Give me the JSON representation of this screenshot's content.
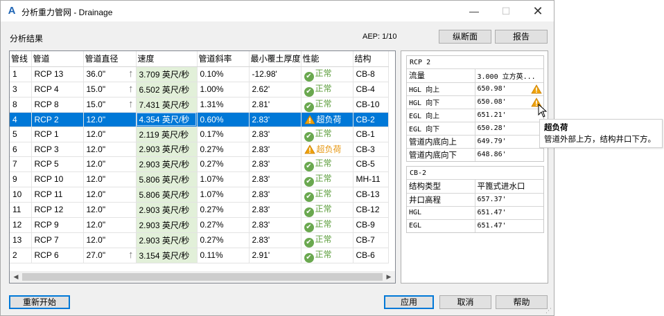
{
  "window": {
    "title": "分析重力管网 - Drainage",
    "app_icon": "A",
    "results_label": "分析结果",
    "aep": "AEP: 1/10",
    "controls": {
      "minimize": "—",
      "maximize": "☐",
      "close": "✕"
    }
  },
  "toolbar": {
    "profile_label": "纵断面",
    "report_label": "报告"
  },
  "table": {
    "columns": [
      "管线",
      "管道",
      "管道直径",
      "速度",
      "管道斜率",
      "最小覆土厚度",
      "性能",
      "结构"
    ],
    "rows": [
      {
        "line": "1",
        "pipe": "RCP 13",
        "dia": "36.0\"",
        "up": "↑",
        "vel": "3.709 英尺/秒",
        "slope": "0.10%",
        "cover": "-12.98'",
        "perf": "正常",
        "perf_type": "ok",
        "struct": "CB-8"
      },
      {
        "line": "3",
        "pipe": "RCP 4",
        "dia": "15.0\"",
        "up": "↑",
        "vel": "6.502 英尺/秒",
        "slope": "1.00%",
        "cover": "2.62'",
        "perf": "正常",
        "perf_type": "ok",
        "struct": "CB-4"
      },
      {
        "line": "8",
        "pipe": "RCP 8",
        "dia": "15.0\"",
        "up": "↑",
        "vel": "7.431 英尺/秒",
        "slope": "1.31%",
        "cover": "2.81'",
        "perf": "正常",
        "perf_type": "ok",
        "struct": "CB-10"
      },
      {
        "line": "4",
        "pipe": "RCP 2",
        "dia": "12.0\"",
        "up": "",
        "vel": "4.354 英尺/秒",
        "slope": "0.60%",
        "cover": "2.83'",
        "perf": "超负荷",
        "perf_type": "warn",
        "struct": "CB-2",
        "selected": true
      },
      {
        "line": "5",
        "pipe": "RCP 1",
        "dia": "12.0\"",
        "up": "",
        "vel": "2.119 英尺/秒",
        "slope": "0.17%",
        "cover": "2.83'",
        "perf": "正常",
        "perf_type": "ok",
        "struct": "CB-1"
      },
      {
        "line": "6",
        "pipe": "RCP 3",
        "dia": "12.0\"",
        "up": "",
        "vel": "2.903 英尺/秒",
        "slope": "0.27%",
        "cover": "2.83'",
        "perf": "超负荷",
        "perf_type": "warn",
        "struct": "CB-3"
      },
      {
        "line": "7",
        "pipe": "RCP 5",
        "dia": "12.0\"",
        "up": "",
        "vel": "2.903 英尺/秒",
        "slope": "0.27%",
        "cover": "2.83'",
        "perf": "正常",
        "perf_type": "ok",
        "struct": "CB-5"
      },
      {
        "line": "9",
        "pipe": "RCP 10",
        "dia": "12.0\"",
        "up": "",
        "vel": "5.806 英尺/秒",
        "slope": "1.07%",
        "cover": "2.83'",
        "perf": "正常",
        "perf_type": "ok",
        "struct": "MH-11"
      },
      {
        "line": "10",
        "pipe": "RCP 11",
        "dia": "12.0\"",
        "up": "",
        "vel": "5.806 英尺/秒",
        "slope": "1.07%",
        "cover": "2.83'",
        "perf": "正常",
        "perf_type": "ok",
        "struct": "CB-13"
      },
      {
        "line": "11",
        "pipe": "RCP 12",
        "dia": "12.0\"",
        "up": "",
        "vel": "2.903 英尺/秒",
        "slope": "0.27%",
        "cover": "2.83'",
        "perf": "正常",
        "perf_type": "ok",
        "struct": "CB-12"
      },
      {
        "line": "12",
        "pipe": "RCP 9",
        "dia": "12.0\"",
        "up": "",
        "vel": "2.903 英尺/秒",
        "slope": "0.27%",
        "cover": "2.83'",
        "perf": "正常",
        "perf_type": "ok",
        "struct": "CB-9"
      },
      {
        "line": "13",
        "pipe": "RCP 7",
        "dia": "12.0\"",
        "up": "",
        "vel": "2.903 英尺/秒",
        "slope": "0.27%",
        "cover": "2.83'",
        "perf": "正常",
        "perf_type": "ok",
        "struct": "CB-7"
      },
      {
        "line": "2",
        "pipe": "RCP 6",
        "dia": "27.0\"",
        "up": "↑",
        "vel": "3.154 英尺/秒",
        "slope": "0.11%",
        "cover": "2.91'",
        "perf": "正常",
        "perf_type": "ok",
        "struct": "CB-6"
      }
    ],
    "scroll_left": "◀",
    "scroll_right": "▶"
  },
  "pipe_props": {
    "title": "RCP 2",
    "rows": [
      {
        "key": "流量",
        "value": "3.000 立方英...",
        "warn": false
      },
      {
        "key": "HGL 向上",
        "value": "650.98'",
        "warn": true
      },
      {
        "key": "HGL 向下",
        "value": "650.08'",
        "warn": true
      },
      {
        "key": "EGL 向上",
        "value": "651.21'",
        "warn": false
      },
      {
        "key": "EGL 向下",
        "value": "650.28'",
        "warn": false
      },
      {
        "key": "管道内底向上",
        "value": "649.79'",
        "warn": false
      },
      {
        "key": "管道内底向下",
        "value": "648.86'",
        "warn": false
      }
    ]
  },
  "structure_props": {
    "title": "CB-2",
    "rows": [
      {
        "key": "结构类型",
        "value": "平篦式进水口"
      },
      {
        "key": "井口高程",
        "value": "657.37'"
      },
      {
        "key": "HGL",
        "value": "651.47'"
      },
      {
        "key": "EGL",
        "value": "651.47'"
      }
    ]
  },
  "tooltip": {
    "title": "超负荷",
    "text": "管道外部上方，结构井口下方。"
  },
  "footer": {
    "restart_label": "重新开始",
    "apply_label": "应用",
    "cancel_label": "取消",
    "help_label": "帮助"
  },
  "icons": {
    "ok": "check-circle-icon",
    "warn": "warning-triangle-icon",
    "flow_up": "up-arrow-icon"
  },
  "colors": {
    "selection": "#0078d7",
    "velocity_cell": "#e2f0d9",
    "ok": "#6aa84f",
    "warning": "#e6960f"
  }
}
